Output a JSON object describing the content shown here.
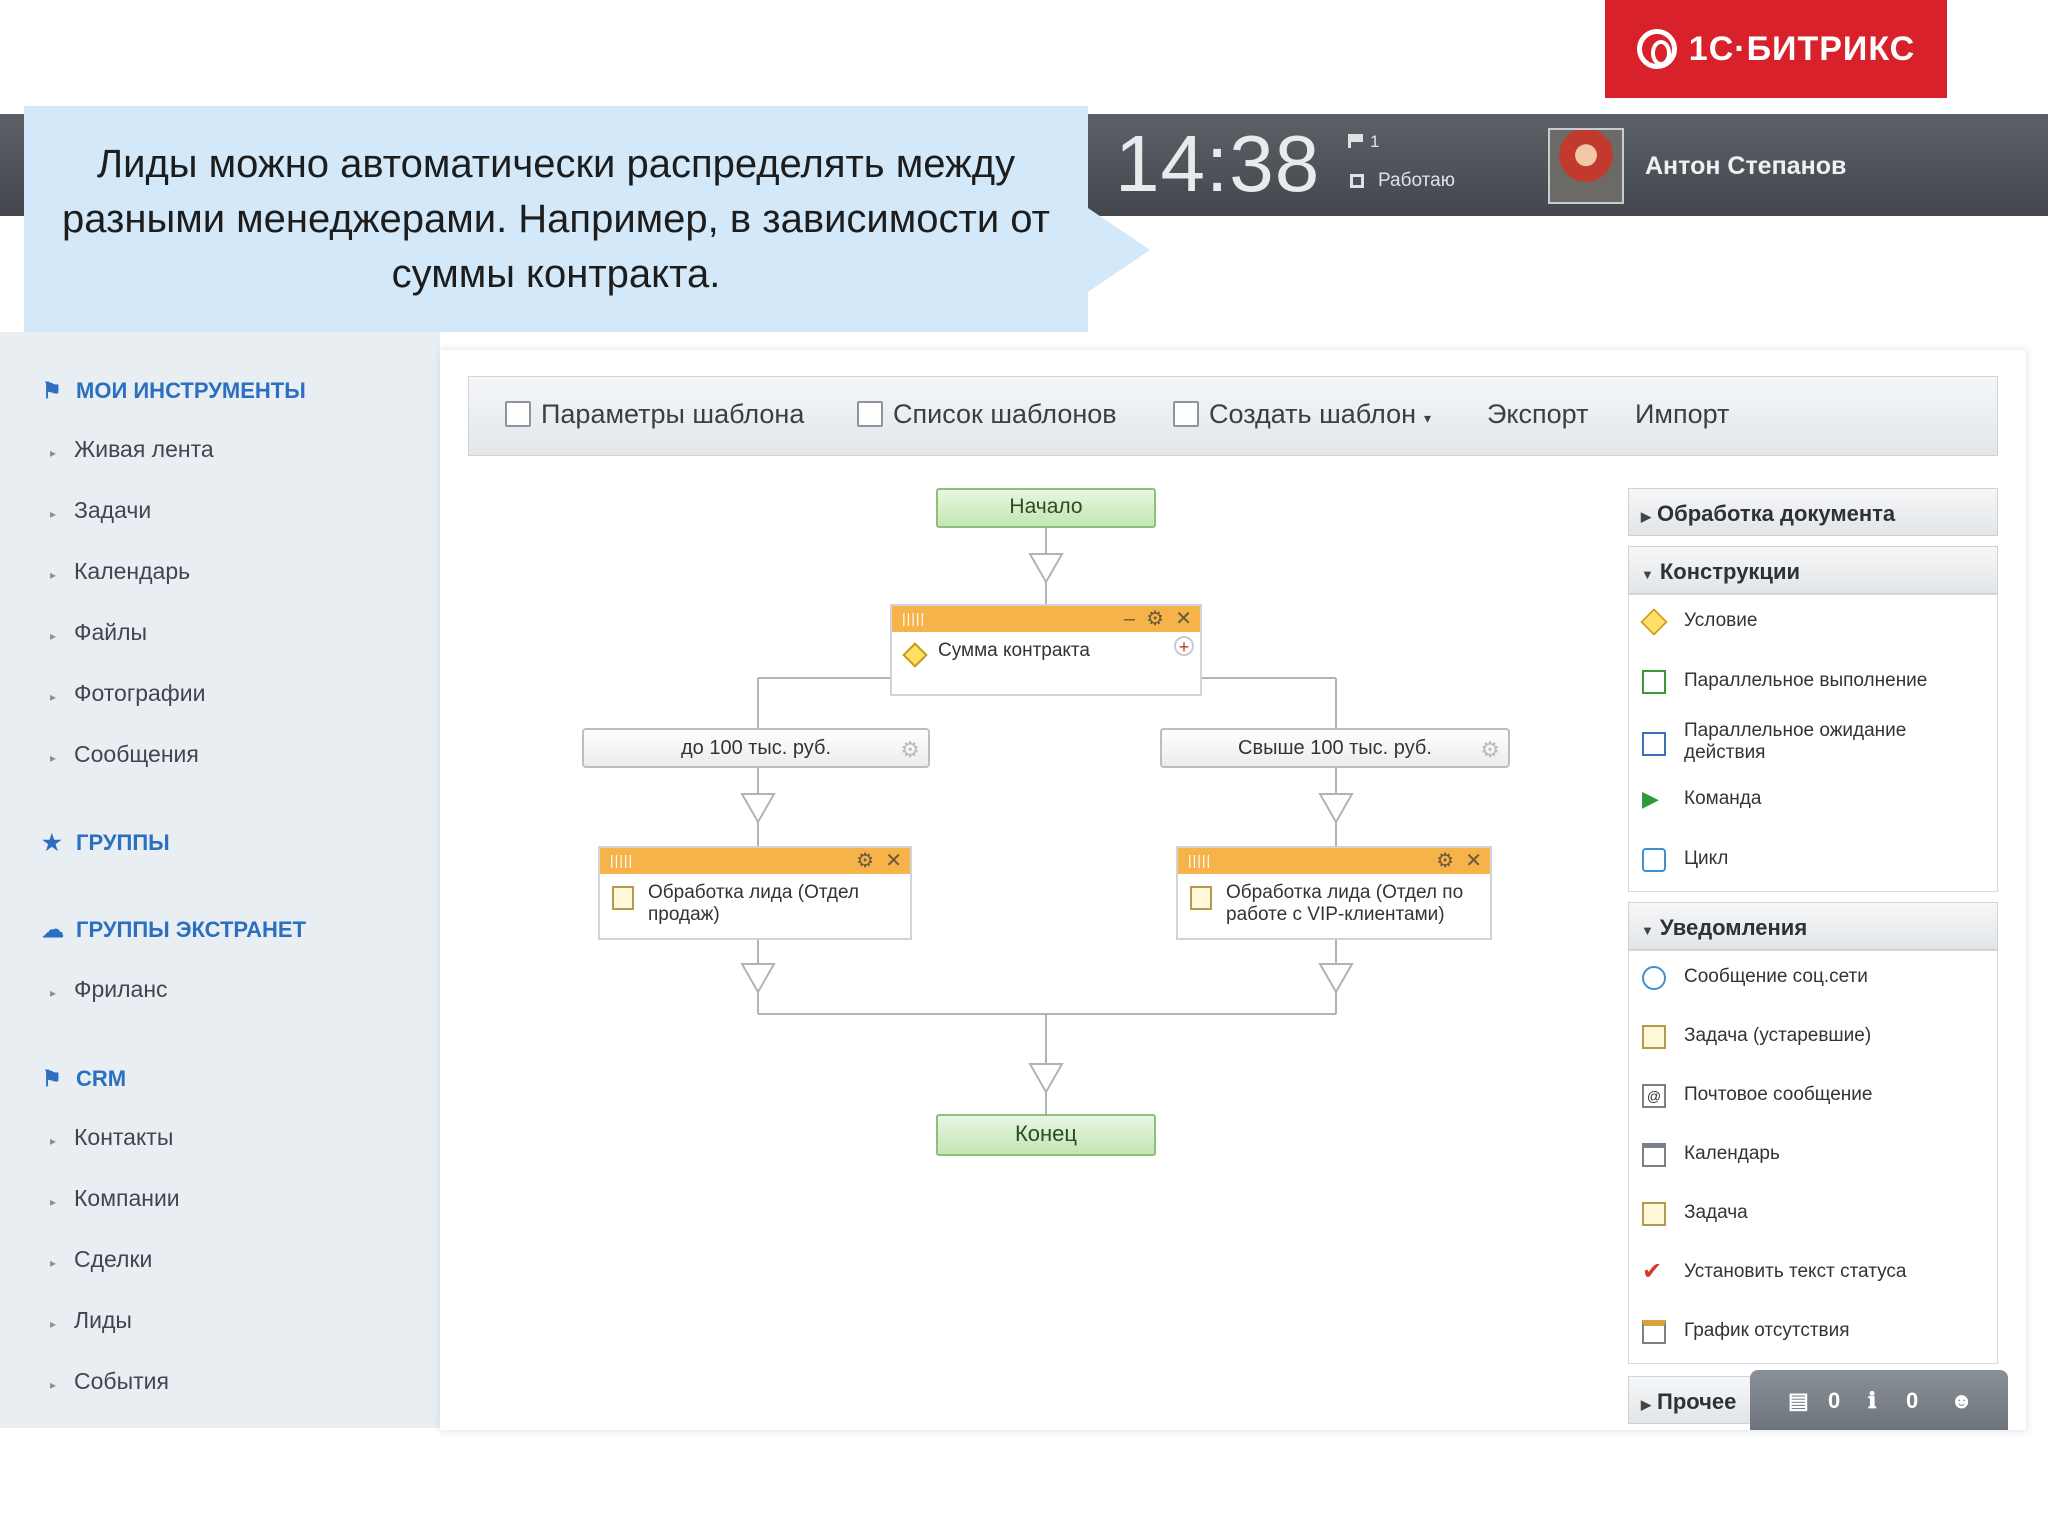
{
  "brand": {
    "logo_text": "1С·БИТРИКС",
    "color": "#d8212a"
  },
  "callout": {
    "text": "Лиды можно автоматически распределять между разными менеджерами. Например, в зависимости от суммы контракта."
  },
  "header": {
    "time": "14:38",
    "flag_count": "1",
    "status": "Работаю",
    "user_name": "Антон Степанов"
  },
  "sidebar": {
    "sections": [
      {
        "title": "МОИ ИНСТРУМЕНТЫ",
        "icon": "bookmark-icon"
      },
      {
        "title": "ГРУППЫ",
        "icon": "group-icon"
      },
      {
        "title": "ГРУППЫ ЭКСТРАНЕТ",
        "icon": "cloud-icon"
      },
      {
        "title": "CRM",
        "icon": "crm-icon"
      }
    ],
    "tools": [
      "Живая лента",
      "Задачи",
      "Календарь",
      "Файлы",
      "Фотографии",
      "Сообщения"
    ],
    "extranet": [
      "Фриланс"
    ],
    "crm": [
      "Контакты",
      "Компании",
      "Сделки",
      "Лиды",
      "События"
    ]
  },
  "toolbar": {
    "template_params": "Параметры шаблона",
    "template_list": "Список шаблонов",
    "create_template": "Создать шаблон",
    "export": "Экспорт",
    "import": "Импорт"
  },
  "flow": {
    "start": "Начало",
    "condition": "Сумма контракта",
    "branch_left": "до 100 тыс. руб.",
    "branch_right": "Свыше 100 тыс. руб.",
    "action_left": "Обработка лида (Отдел продаж)",
    "action_right": "Обработка лида (Отдел по работе с VIP-клиентами)",
    "end": "Конец"
  },
  "palette": {
    "doc_processing": "Обработка документа",
    "constructs_title": "Конструкции",
    "constructs": [
      "Условие",
      "Параллельное выполнение",
      "Параллельное ожидание действия",
      "Команда",
      "Цикл"
    ],
    "notifications_title": "Уведомления",
    "notifications": [
      "Сообщение соц.сети",
      "Задача (устаревшие)",
      "Почтовое сообщение",
      "Календарь",
      "Задача",
      "Установить текст статуса",
      "График отсутствия"
    ],
    "other": "Прочее"
  },
  "bottom_bar": {
    "messages": "0",
    "notifications": "0"
  }
}
